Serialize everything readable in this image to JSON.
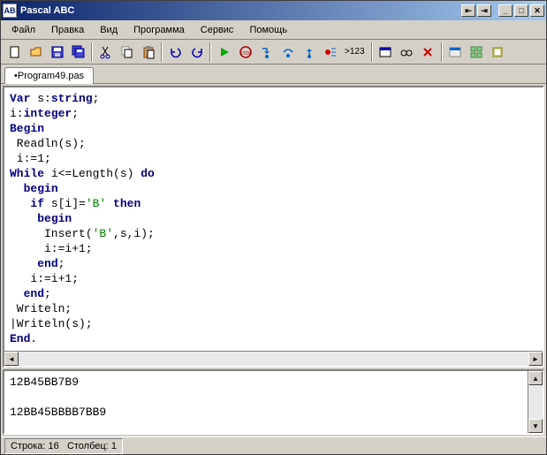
{
  "window": {
    "title": "Pascal ABC"
  },
  "menu": [
    "Файл",
    "Правка",
    "Вид",
    "Программа",
    "Сервис",
    "Помощь"
  ],
  "tab": {
    "name": "•Program49.pas"
  },
  "code_tokens": [
    [
      [
        "kw",
        "Var"
      ],
      [
        "",
        " s:"
      ],
      [
        "kw",
        "string"
      ],
      [
        "",
        ";"
      ]
    ],
    [
      [
        "",
        "i:"
      ],
      [
        "kw",
        "integer"
      ],
      [
        "",
        ";"
      ]
    ],
    [
      [
        "kw",
        "Begin"
      ]
    ],
    [
      [
        "",
        " Readln(s);"
      ]
    ],
    [
      [
        "",
        " i:=1;"
      ]
    ],
    [
      [
        "kw",
        "While"
      ],
      [
        "",
        " i<=Length(s) "
      ],
      [
        "kw",
        "do"
      ]
    ],
    [
      [
        "",
        "  "
      ],
      [
        "kw",
        "begin"
      ]
    ],
    [
      [
        "",
        "   "
      ],
      [
        "kw",
        "if"
      ],
      [
        "",
        " s[i]="
      ],
      [
        "str",
        "'B'"
      ],
      [
        "",
        " "
      ],
      [
        "kw",
        "then"
      ]
    ],
    [
      [
        "",
        "    "
      ],
      [
        "kw",
        "begin"
      ]
    ],
    [
      [
        "",
        "     Insert("
      ],
      [
        "str",
        "'B'"
      ],
      [
        "",
        ",s,i);"
      ]
    ],
    [
      [
        "",
        "     i:=i+1;"
      ]
    ],
    [
      [
        "",
        "    "
      ],
      [
        "kw",
        "end"
      ],
      [
        "",
        ";"
      ]
    ],
    [
      [
        "",
        "   i:=i+1;"
      ]
    ],
    [
      [
        "",
        "  "
      ],
      [
        "kw",
        "end"
      ],
      [
        "",
        ";"
      ]
    ],
    [
      [
        "",
        " Writeln;"
      ]
    ],
    [
      [
        "",
        "|Writeln(s);"
      ]
    ],
    [
      [
        "kw",
        "End"
      ],
      [
        "",
        "."
      ]
    ]
  ],
  "output": [
    "12B45BB7B9",
    "",
    "12BB45BBBB7BB9"
  ],
  "status": {
    "line_label": "Строка:",
    "line": "16",
    "col_label": "Столбец:",
    "col": "1"
  },
  "toolbar_text": {
    "var": ">123"
  }
}
